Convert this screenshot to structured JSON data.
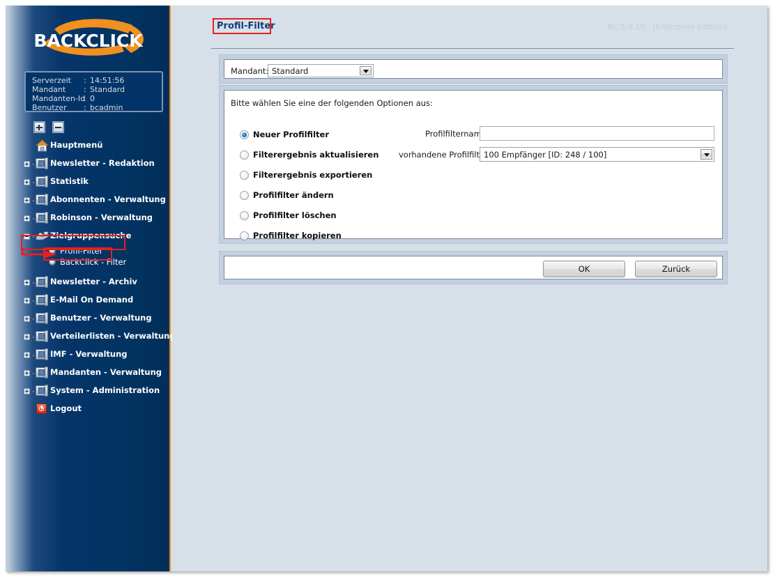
{
  "window": {
    "brand": "BACKCLICK",
    "version_label": "BC 5.9.10 - [Enterprise Edition]"
  },
  "sidebar": {
    "server_info": {
      "rows": [
        {
          "label": "Serverzeit",
          "separator": ":",
          "value": "14:51:56"
        },
        {
          "label": "Mandant",
          "separator": ":",
          "value": "Standard"
        },
        {
          "label": "Mandanten-Id",
          "separator": ":",
          "value": "0"
        },
        {
          "label": "Benutzer",
          "separator": ":",
          "value": "bcadmin"
        }
      ]
    },
    "tree_tools": [
      {
        "name": "expand-all-button",
        "icon": "plus-icon"
      },
      {
        "name": "collapse-all-button",
        "icon": "minus-icon"
      }
    ],
    "items": [
      {
        "label": "Hauptmenü",
        "icon": "home-icon",
        "expander": "none"
      },
      {
        "label": "Newsletter - Redaktion",
        "icon": "folder-icon",
        "expander": "plus"
      },
      {
        "label": "Statistik",
        "icon": "folder-icon",
        "expander": "plus"
      },
      {
        "label": "Abonnenten - Verwaltung",
        "icon": "folder-icon",
        "expander": "plus"
      },
      {
        "label": "Robinson - Verwaltung",
        "icon": "folder-icon",
        "expander": "plus"
      },
      {
        "label": "Zielgruppensuche",
        "icon": "target-group-icon",
        "expander": "minus"
      },
      {
        "label": "Newsletter - Archiv",
        "icon": "folder-icon",
        "expander": "plus"
      },
      {
        "label": "E-Mail On Demand",
        "icon": "folder-icon",
        "expander": "plus"
      },
      {
        "label": "Benutzer - Verwaltung",
        "icon": "folder-icon",
        "expander": "plus"
      },
      {
        "label": "Verteilerlisten - Verwaltung",
        "icon": "folder-icon",
        "expander": "plus"
      },
      {
        "label": "IMF - Verwaltung",
        "icon": "folder-icon",
        "expander": "plus"
      },
      {
        "label": "Mandanten - Verwaltung",
        "icon": "folder-icon",
        "expander": "plus"
      },
      {
        "label": "System - Administration",
        "icon": "folder-icon",
        "expander": "plus"
      },
      {
        "label": "Logout",
        "icon": "logout-icon",
        "expander": "none"
      }
    ],
    "sub_items": [
      {
        "label": "Profil-Filter",
        "icon": "sphere-icon",
        "selected": true
      },
      {
        "label": "BackClick - Filter",
        "icon": "sphere-icon",
        "selected": false
      }
    ]
  },
  "main": {
    "title": "Profil-Filter",
    "mandant": {
      "label": "Mandant:",
      "selected": "Standard"
    },
    "instruction": "Bitte wählen Sie eine der folgenden Optionen aus:",
    "options": [
      {
        "label": "Neuer Profilfilter",
        "selected": true
      },
      {
        "label": "Filterergebnis aktualisieren",
        "selected": false
      },
      {
        "label": "Filterergebnis exportieren",
        "selected": false
      },
      {
        "label": "Profilfilter ändern",
        "selected": false
      },
      {
        "label": "Profilfilter löschen",
        "selected": false
      },
      {
        "label": "Profilfilter kopieren",
        "selected": false
      }
    ],
    "fields": {
      "profilfiltername": {
        "label": "Profilfiltername:",
        "value": "",
        "placeholder": ""
      },
      "vorhandene": {
        "label": "vorhandene Profilfilter:",
        "selected": "100 Empfänger [ID: 248 / 100]"
      }
    },
    "buttons": {
      "ok": "OK",
      "back": "Zurück"
    }
  },
  "annotations": {
    "accent_color": "#e81f1f",
    "boxes": [
      "page-title",
      "sidebar-item-zielgruppensuche",
      "sidebar-subitem-profil-filter"
    ],
    "arrow": "points to Profil-Filter"
  },
  "colors": {
    "sidebar_dark": "#023463",
    "sidebar_accent": "#e8921c",
    "content_bg": "#d7dfe8",
    "panel_bg": "#c3d0e0",
    "title_blue": "#123d7a",
    "annotation_red": "#e81f1f"
  }
}
